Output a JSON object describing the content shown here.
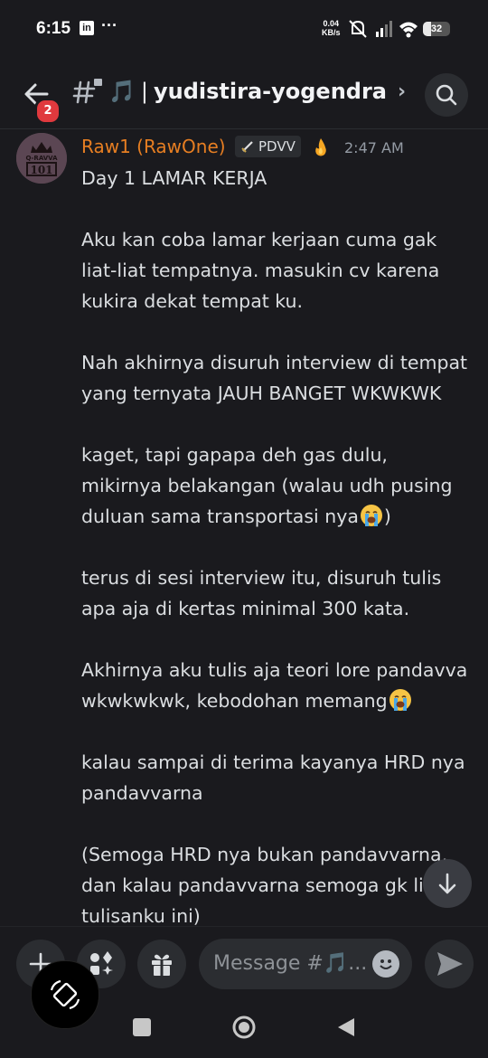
{
  "status": {
    "time": "6:15",
    "linkedin_icon": "linkedin-icon",
    "more": "···",
    "speed_value": "0.04",
    "speed_unit": "KB/s",
    "battery": "32"
  },
  "header": {
    "notification_badge": "2",
    "channel_emoji": "🎵",
    "separator": "|",
    "channel_name": "yudistira-yogendra",
    "chevron": "›"
  },
  "message": {
    "author": "Raw1 (RawOne)",
    "tag": "PDVV",
    "timestamp": "2:47 AM",
    "avatar_text_top": "Q-RAVVA",
    "avatar_text_bottom": "101",
    "lines": [
      "Day 1 LAMAR KERJA",
      "",
      "Aku kan coba lamar kerjaan cuma gak liat-liat tempatnya. masukin cv karena kukira dekat tempat ku.",
      "",
      "Nah akhirnya disuruh interview di tempat yang ternyata JAUH BANGET WKWKWK",
      "",
      "kaget, tapi gapapa deh gas dulu, mikirnya belakangan (walau udh pusing duluan sama transportasi nya"
    ],
    "line_after_emoji_1": ")",
    "paragraph_4": "terus di sesi interview itu, disuruh tulis apa aja di kertas minimal 300 kata.",
    "paragraph_5": "Akhirnya aku tulis aja teori lore pandavva wkwkwkwk, kebodohan memang",
    "paragraph_6": "kalau sampai di terima kayanya HRD nya pandavvarna",
    "paragraph_7": "(Semoga HRD nya bukan pandavvarna, dan kalau pandavvarna semoga gk liat tulisanku ini)"
  },
  "composer": {
    "placeholder": "Message #🎵..."
  },
  "colors": {
    "background": "#1a1a1e",
    "author": "#e67e22",
    "accent_red": "#e0393e"
  }
}
